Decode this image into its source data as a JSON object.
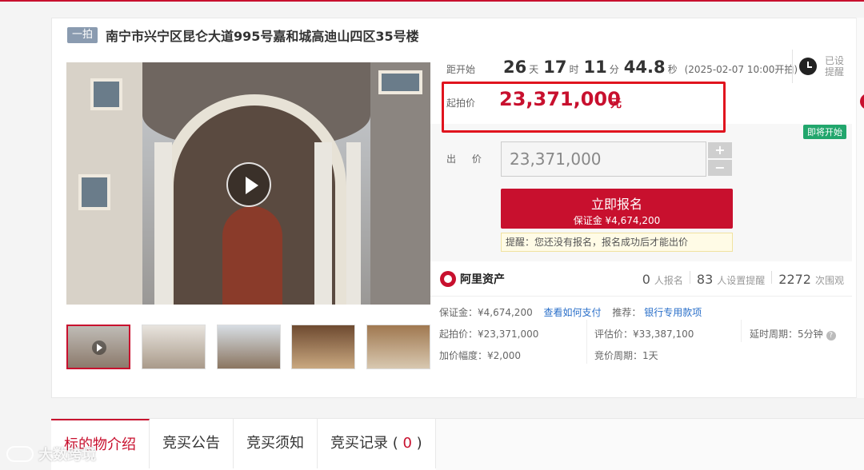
{
  "header": {
    "badge": "一拍",
    "title": "南宁市兴宁区昆仑大道995号嘉和城高迪山四区35号楼"
  },
  "countdown": {
    "label": "距开始",
    "days": "26",
    "days_unit": "天",
    "hours": "17",
    "hours_unit": "时",
    "minutes": "11",
    "minutes_unit": "分",
    "seconds": "44.8",
    "seconds_unit": "秒",
    "start_time": "(2025-02-07 10:00开拍)"
  },
  "reminder": {
    "label": "已设提醒"
  },
  "price": {
    "label": "起拍价",
    "value": "23,371,000",
    "unit": "元"
  },
  "status_tag": "即将开始",
  "bid": {
    "label": "出 价",
    "input_value": "23,371,000",
    "plus": "+",
    "minus": "−"
  },
  "signup": {
    "label": "立即报名",
    "deposit": "保证金 ¥4,674,200"
  },
  "tip": "提醒：您还没有报名，报名成功后才能出价",
  "platform": {
    "name": "阿里资产"
  },
  "stats": {
    "registrants": "0",
    "registrants_label": "人报名",
    "reminders": "83",
    "reminders_label": "人设置提醒",
    "views": "2272",
    "views_label": "次围观"
  },
  "info": {
    "deposit": "保证金：¥4,674,200",
    "how_to_pay": "查看如何支付",
    "recommend_label": "推荐：",
    "recommend_link": "银行专用款项",
    "start_price": "起拍价：¥23,371,000",
    "appraisal": "评估价：¥33,387,100",
    "extension": "延时周期：5分钟",
    "increment": "加价幅度：¥2,000",
    "cycle": "竞价周期：1天"
  },
  "tabs": [
    {
      "label": "标的物介绍"
    },
    {
      "label": "竞买公告"
    },
    {
      "label": "竞买须知"
    },
    {
      "label": "竞买记录 (",
      "count": "0",
      "close": ")"
    }
  ],
  "watermark": "大数跨境",
  "colors": {
    "accent": "#c8102e",
    "link": "#2a6fc9",
    "status_green": "#21a66c"
  }
}
